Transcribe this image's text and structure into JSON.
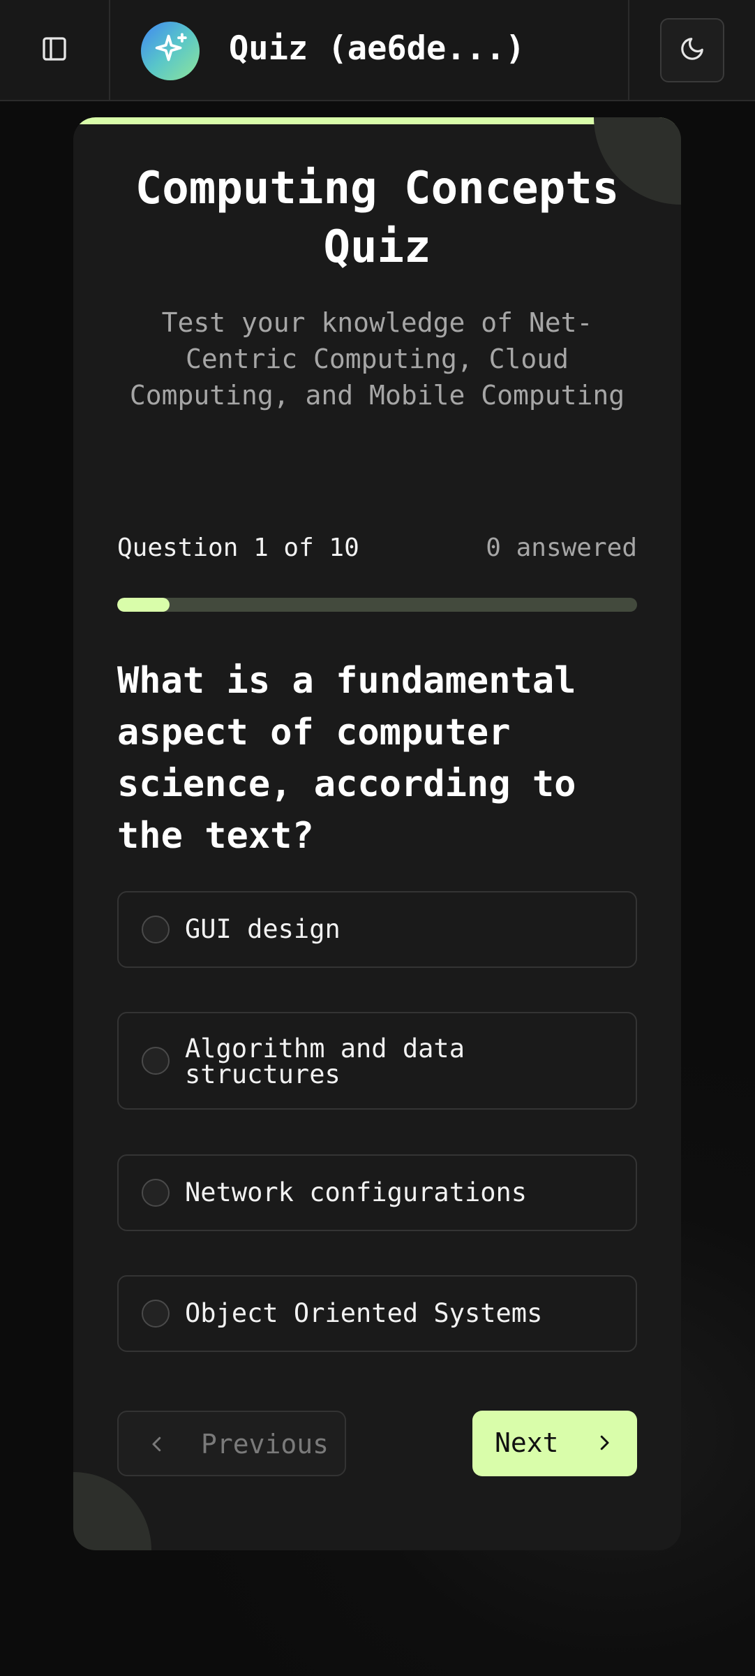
{
  "header": {
    "title": "Quiz (ae6de...)",
    "sidebar_toggle_icon": "sidebar-panel-icon",
    "logo_icon": "sparkle-icon",
    "theme_toggle_icon": "moon-icon"
  },
  "quiz": {
    "title": "Computing Concepts Quiz",
    "subtitle": "Test your knowledge of Net-Centric Computing, Cloud Computing, and Mobile Computing",
    "progress_label": "Question 1 of 10",
    "answered_label": "0 answered",
    "progress_fraction": 0.1,
    "question": "What is a fundamental aspect of computer science, according to the text?",
    "options": [
      {
        "label": "GUI design"
      },
      {
        "label": "Algorithm and data structures"
      },
      {
        "label": "Network configurations"
      },
      {
        "label": "Object Oriented Systems"
      }
    ],
    "previous_label": "Previous",
    "next_label": "Next"
  },
  "colors": {
    "accent": "#d9fdaa",
    "background": "#0e0e0e",
    "card": "#1a1a1a",
    "progress_track": "#434a3d"
  }
}
